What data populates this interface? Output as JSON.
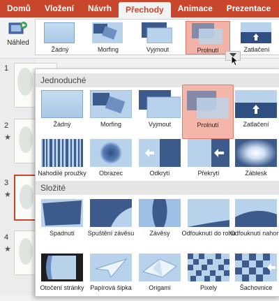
{
  "ribbon": {
    "tabs": [
      "Domů",
      "Vložení",
      "Návrh",
      "Přechody",
      "Animace",
      "Prezentace"
    ],
    "active_tab": "Přechody",
    "preview_label": "Náhled",
    "gallery_items": [
      "Žádný",
      "Morfing",
      "Vyjmout",
      "Prolnutí",
      "Zatlačení"
    ],
    "selected_item": "Prolnutí"
  },
  "slides": {
    "numbers": [
      "1",
      "2",
      "3",
      "4"
    ],
    "star": "★"
  },
  "dropdown": {
    "sections": [
      {
        "title": "Jednoduché",
        "items": [
          "Žádný",
          "Morfing",
          "Vyjmout",
          "Prolnutí",
          "Zatlačení",
          "Nahodilé proužky",
          "Obrazec",
          "Odkrytí",
          "Překrytí",
          "Záblesk"
        ]
      },
      {
        "title": "Složité",
        "items": [
          "Spadnutí",
          "Spuštění závěsu",
          "Závěsy",
          "Odfouknutí do rohu",
          "Odfouknutí nahoru",
          "Otočení stránky",
          "Papírová šipka",
          "Origami",
          "Pixely",
          "Šachovnice"
        ]
      }
    ],
    "selected_item": "Prolnutí"
  },
  "colors": {
    "accent": "#c8462b",
    "selected_bg": "#f4b6a8",
    "thumb_blue": "#a8c8e6",
    "thumb_dark": "#3c5a8c"
  }
}
